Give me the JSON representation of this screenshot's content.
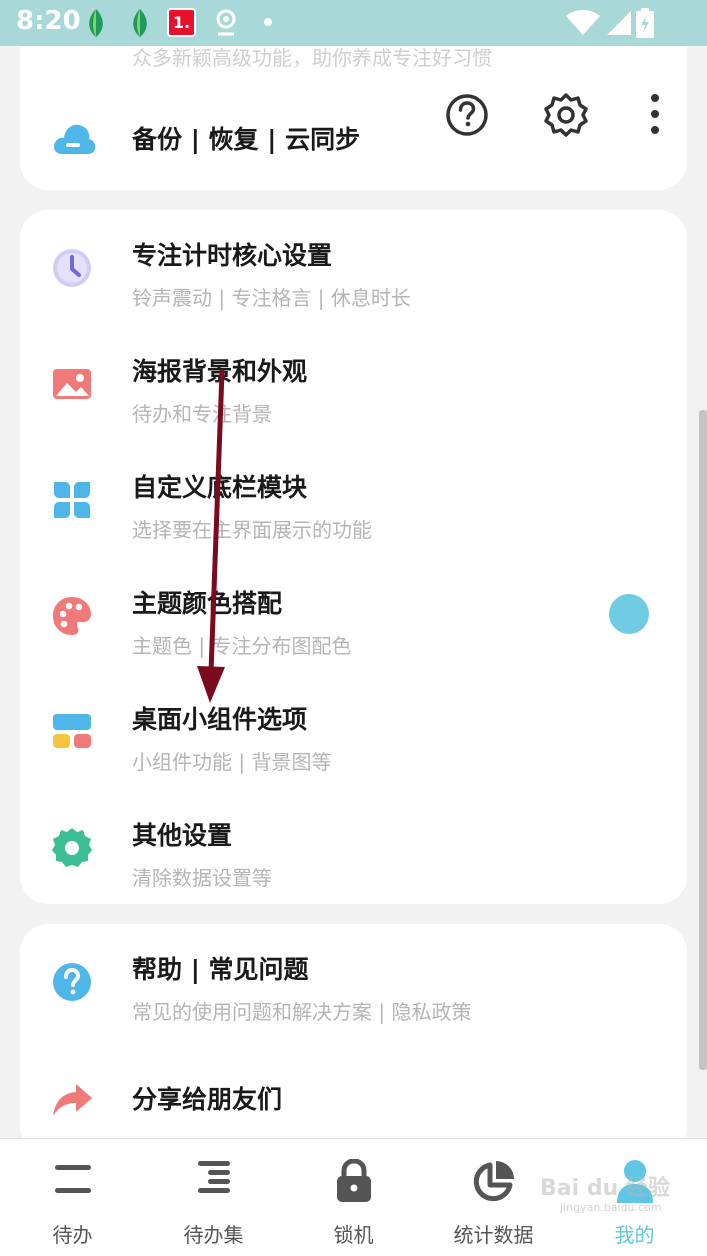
{
  "status_bar": {
    "time": "8:20",
    "notification_badge": "1."
  },
  "top_card": {
    "faded_subtitle": "众多新颖高级功能，助你养成专注好习惯",
    "backup_title": "备份 | 恢复 | 云同步",
    "actions": [
      "help-icon",
      "settings-icon",
      "more-vert-icon"
    ]
  },
  "settings": [
    {
      "title": "专注计时核心设置",
      "subtitle": "铃声震动 | 专注格言 | 休息时长",
      "icon": "clock-icon",
      "color": "#8a86e0"
    },
    {
      "title": "海报背景和外观",
      "subtitle": "待办和专注背景",
      "icon": "image-icon",
      "color": "#f07a7a"
    },
    {
      "title": "自定义底栏模块",
      "subtitle": "选择要在主界面展示的功能",
      "icon": "grid-icon",
      "color": "#4fb6ea"
    },
    {
      "title": "主题颜色搭配",
      "subtitle": "主题色 | 专注分布图配色",
      "icon": "palette-icon",
      "color": "#f07a7a",
      "accent": "#6ecbe2"
    },
    {
      "title": "桌面小组件选项",
      "subtitle": "小组件功能 | 背景图等",
      "icon": "widget-icon",
      "color": "#4fb6ea"
    },
    {
      "title": "其他设置",
      "subtitle": "清除数据设置等",
      "icon": "gear-icon",
      "color": "#3dbf95"
    }
  ],
  "help": {
    "title": "帮助 | 常见问题",
    "subtitle": "常见的使用问题和解决方案 | 隐私政策",
    "share_title": "分享给朋友们"
  },
  "bottom_nav": [
    {
      "label": "待办",
      "icon": "todo-icon",
      "active": false
    },
    {
      "label": "待办集",
      "icon": "todo-list-icon",
      "active": false
    },
    {
      "label": "锁机",
      "icon": "lock-icon",
      "active": false
    },
    {
      "label": "统计数据",
      "icon": "pie-chart-icon",
      "active": false
    },
    {
      "label": "我的",
      "icon": "profile-icon",
      "active": true
    }
  ],
  "watermark": {
    "text": "Bai du 经验",
    "sub": "jingyan.baidu.com"
  },
  "colors": {
    "accent": "#5ec7e6",
    "status_bar": "#a8d8d8",
    "annotation_arrow": "#7a0a1e"
  }
}
